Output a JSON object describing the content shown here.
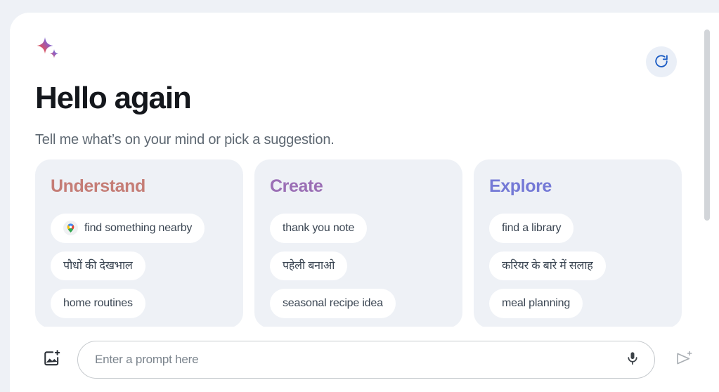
{
  "header": {
    "logo_icon": "gemini-sparkle-icon",
    "greeting": "Hello again",
    "subtitle": "Tell me what’s on your mind or pick a suggestion.",
    "refresh_icon": "refresh-icon",
    "refresh_label": "Refresh suggestions"
  },
  "colors": {
    "page_background": "#eef1f6",
    "surface": "#ffffff",
    "card_background": "#eef1f6",
    "understand_accent": "#c57d76",
    "create_accent": "#9b6fb5",
    "explore_accent": "#7479d6",
    "refresh_icon_color": "#1b5cc4",
    "refresh_button_background": "#eaeff7",
    "heading_text": "#14171c",
    "subtitle_text": "#5e6872",
    "chip_text": "#3b4653",
    "scrollbar_thumb": "#d2d5d9"
  },
  "cards": [
    {
      "title": "Understand",
      "accent": "#c57d76",
      "chips": [
        {
          "label": "find something nearby",
          "icon": "google-maps-pin-icon"
        },
        {
          "label": "पौधों की देखभाल",
          "icon": null
        },
        {
          "label": "home routines",
          "icon": null
        }
      ]
    },
    {
      "title": "Create",
      "accent": "#9b6fb5",
      "chips": [
        {
          "label": "thank you note",
          "icon": null
        },
        {
          "label": "पहेली बनाओ",
          "icon": null
        },
        {
          "label": "seasonal recipe idea",
          "icon": null
        }
      ]
    },
    {
      "title": "Explore",
      "accent": "#7479d6",
      "chips": [
        {
          "label": "find a library",
          "icon": null
        },
        {
          "label": "करियर के बारे में सलाह",
          "icon": null
        },
        {
          "label": "meal planning",
          "icon": null
        }
      ]
    }
  ],
  "composer": {
    "add_image_icon": "add-image-icon",
    "add_image_label": "Add image",
    "prompt_placeholder": "Enter a prompt here",
    "prompt_value": "",
    "mic_icon": "microphone-icon",
    "mic_label": "Use microphone",
    "send_icon": "send-sparkle-icon",
    "send_label": "Send"
  },
  "scrollbar": {
    "name": "vertical-scrollbar"
  }
}
